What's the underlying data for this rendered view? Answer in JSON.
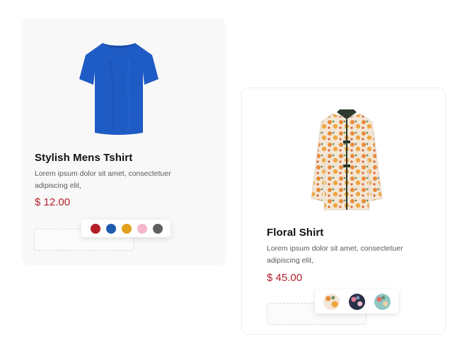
{
  "products": [
    {
      "title": "Stylish Mens Tshirt",
      "description": "Lorem ipsum dolor sit amet, consectetuer adipiscing elit,",
      "price": "$ 12.00",
      "image": "blue-tshirt",
      "swatches": [
        "#b32028",
        "#1f5bb0",
        "#e2a01f",
        "#f5b7cc",
        "#5f5f5f"
      ]
    },
    {
      "title": "Floral Shirt",
      "description": "Lorem ipsum dolor sit amet, consectetuer adipiscing elit,",
      "price": "$ 45.00",
      "image": "floral-shirt",
      "swatches": [
        "floral-orange-pattern",
        "floral-navy-pattern",
        "floral-teal-pattern"
      ]
    }
  ]
}
